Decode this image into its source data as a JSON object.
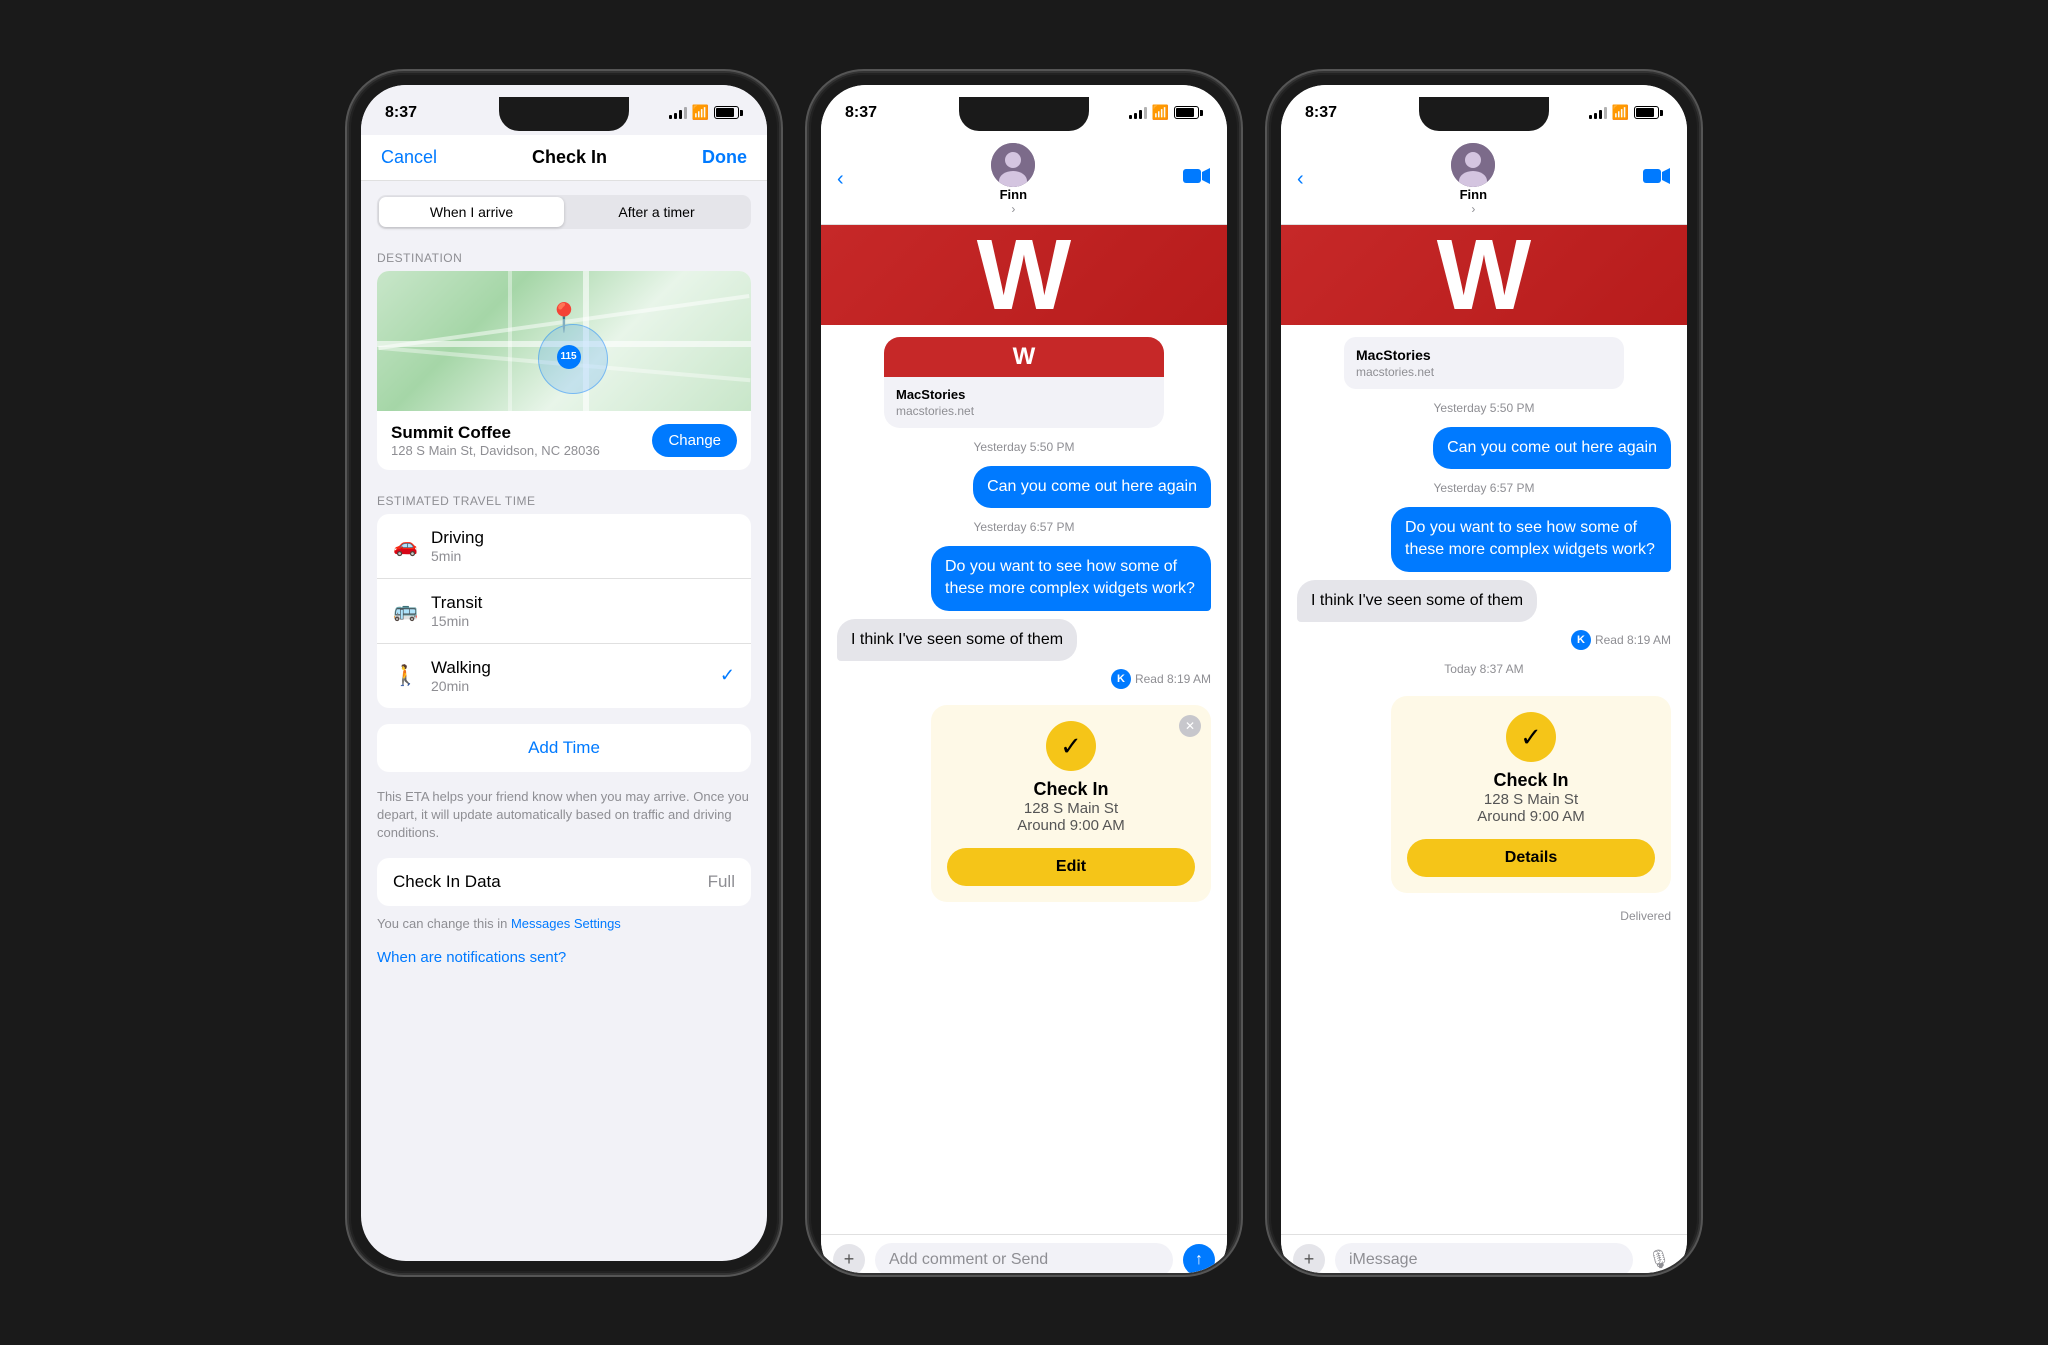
{
  "phones": {
    "phone1": {
      "status": {
        "time": "8:37",
        "signal": 3,
        "wifi": true,
        "battery": 85
      },
      "header": {
        "cancel": "Cancel",
        "title": "Check In",
        "done": "Done"
      },
      "segments": {
        "option1": "When I arrive",
        "option2": "After a timer",
        "active": 0
      },
      "destination_label": "DESTINATION",
      "destination": {
        "name": "Summit Coffee",
        "address": "128 S Main St, Davidson, NC  28036",
        "change_btn": "Change"
      },
      "travel_label": "ESTIMATED TRAVEL TIME",
      "travel_options": [
        {
          "icon": "🚗",
          "name": "Driving",
          "time": "5min",
          "selected": false
        },
        {
          "icon": "🚌",
          "name": "Transit",
          "time": "15min",
          "selected": false
        },
        {
          "icon": "🚶",
          "name": "Walking",
          "time": "20min",
          "selected": true
        }
      ],
      "add_time": "Add Time",
      "eta_note": "This ETA helps your friend know when you may arrive. Once you depart, it will update automatically based on traffic and driving conditions.",
      "checkin_data": {
        "label": "Check In Data",
        "value": "Full"
      },
      "settings_note": "You can change this in ",
      "settings_link": "Messages Settings",
      "notifications_link": "When are notifications sent?"
    },
    "phone2": {
      "status": {
        "time": "8:37",
        "signal": 3,
        "wifi": true,
        "battery": 85
      },
      "nav": {
        "back_icon": "‹",
        "contact": "Finn",
        "chevron": "›",
        "video_icon": "📹"
      },
      "messages": [
        {
          "type": "link_card",
          "site": "MacStories",
          "url": "macstories.net"
        },
        {
          "type": "timestamp",
          "text": "Yesterday 5:50 PM"
        },
        {
          "type": "sent",
          "text": "Can you come out here again"
        },
        {
          "type": "timestamp",
          "text": "Yesterday 6:57 PM"
        },
        {
          "type": "sent",
          "text": "Do you want to see how some of these more complex widgets work?"
        },
        {
          "type": "received",
          "text": "I think I've seen some of them"
        },
        {
          "type": "read",
          "avatar": "K",
          "time": "Read 8:19 AM"
        }
      ],
      "checkin_card": {
        "title": "Check In",
        "address": "128 S Main St",
        "time": "Around 9:00 AM",
        "edit_btn": "Edit"
      },
      "input": {
        "placeholder": "Add comment or Send",
        "plus_icon": "+",
        "send_icon": "↑"
      }
    },
    "phone3": {
      "status": {
        "time": "8:37",
        "signal": 3,
        "wifi": true,
        "battery": 85
      },
      "nav": {
        "back_icon": "‹",
        "contact": "Finn",
        "chevron": "›",
        "video_icon": "📹"
      },
      "messages": [
        {
          "type": "link_card",
          "site": "MacStories",
          "url": "macstories.net"
        },
        {
          "type": "timestamp",
          "text": "Yesterday 5:50 PM"
        },
        {
          "type": "sent",
          "text": "Can you come out here again"
        },
        {
          "type": "timestamp",
          "text": "Yesterday 6:57 PM"
        },
        {
          "type": "sent",
          "text": "Do you want to see how some of these more complex widgets work?"
        },
        {
          "type": "received",
          "text": "I think I've seen some of them"
        },
        {
          "type": "read",
          "avatar": "K",
          "time": "Read 8:19 AM"
        },
        {
          "type": "timestamp",
          "text": "Today 8:37 AM"
        }
      ],
      "checkin_card": {
        "title": "Check In",
        "address": "128 S Main St",
        "time": "Around 9:00 AM",
        "details_btn": "Details"
      },
      "delivered": "Delivered",
      "input": {
        "placeholder": "iMessage",
        "plus_icon": "+",
        "mic_icon": "🎙"
      }
    }
  }
}
